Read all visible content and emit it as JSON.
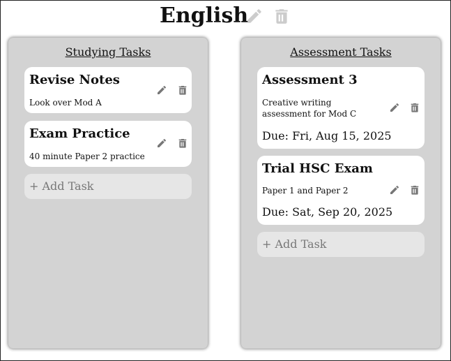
{
  "header": {
    "title": "English",
    "edit_icon": "pencil-icon",
    "delete_icon": "trash-icon",
    "icon_color": "#cccccc"
  },
  "columns": [
    {
      "title": "Studying Tasks",
      "cards": [
        {
          "title": "Revise Notes",
          "description": "Look over Mod A",
          "due": ""
        },
        {
          "title": "Exam Practice",
          "description": "40 minute Paper 2 practice",
          "due": ""
        }
      ],
      "add_label": "+ Add Task"
    },
    {
      "title": "Assessment Tasks",
      "cards": [
        {
          "title": "Assessment 3",
          "description": "Creative writing assessment for Mod C",
          "due": "Due: Fri, Aug 15, 2025"
        },
        {
          "title": "Trial HSC Exam",
          "description": "Paper 1 and Paper 2",
          "due": "Due: Sat, Sep 20, 2025"
        }
      ],
      "add_label": "+ Add Task"
    }
  ],
  "colors": {
    "column_bg": "#d3d3d3",
    "card_bg": "#ffffff",
    "add_bg": "#e6e6e6",
    "card_icon": "#777777"
  }
}
